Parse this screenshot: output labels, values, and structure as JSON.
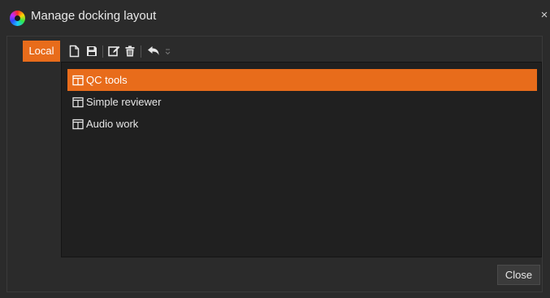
{
  "window": {
    "title": "Manage docking layout",
    "close_glyph": "×",
    "app_icon": "color-wheel-icon"
  },
  "tabs": [
    {
      "label": "Local",
      "active": true
    }
  ],
  "toolbar": {
    "buttons": [
      {
        "name": "new-layout-button",
        "icon": "new-file-icon"
      },
      {
        "name": "save-layout-button",
        "icon": "floppy-disk-icon"
      },
      {
        "name": "edit-layout-button",
        "icon": "edit-icon"
      },
      {
        "name": "delete-layout-button",
        "icon": "trash-icon"
      },
      {
        "name": "undo-button",
        "icon": "undo-icon"
      },
      {
        "name": "toolbar-overflow-button",
        "icon": "chevron-down-icon"
      }
    ]
  },
  "layouts": [
    {
      "label": "QC tools",
      "selected": true,
      "icon": "layout-icon"
    },
    {
      "label": "Simple reviewer",
      "selected": false,
      "icon": "layout-icon"
    },
    {
      "label": "Audio work",
      "selected": false,
      "icon": "layout-icon"
    }
  ],
  "footer": {
    "close_label": "Close"
  },
  "colors": {
    "accent": "#e86c1b",
    "background": "#2b2b2b",
    "panel": "#202020",
    "text": "#e6e6e6"
  }
}
